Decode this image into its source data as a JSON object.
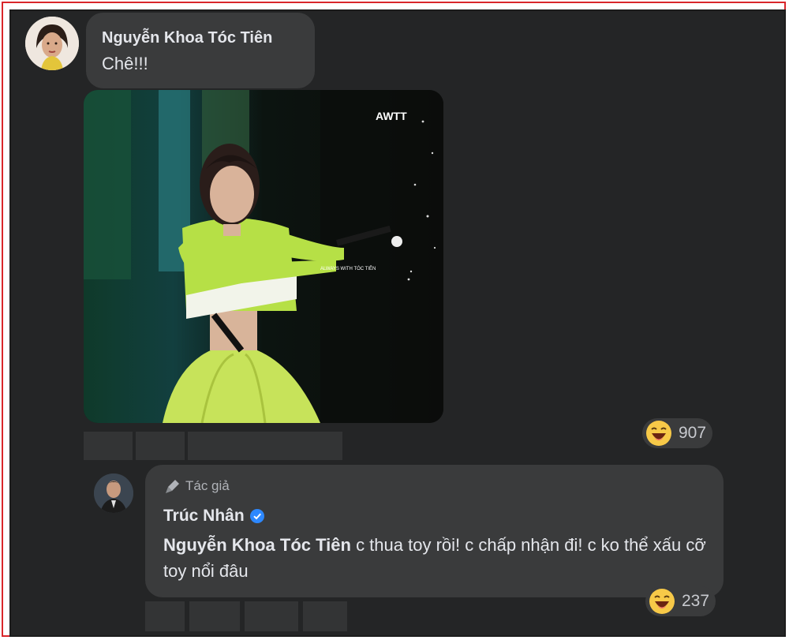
{
  "comment": {
    "author": "Nguyễn Khoa Tóc Tiên",
    "text": "Chê!!!",
    "photo_watermark_top": "AWTT",
    "photo_watermark_mid": "ALWAYS WITH TÓC TIÊN",
    "reaction_icon": "laughing-emoji-icon",
    "reaction_count": "907"
  },
  "reply": {
    "author_tag": "Tác giả",
    "author": "Trúc Nhân",
    "verified_icon": "verified-badge-icon",
    "mention": "Nguyễn Khoa Tóc Tiên",
    "text": " c thua toy rồi! c chấp nhận đi! c ko thể xấu cỡ toy nổi đâu",
    "reaction_icon": "laughing-emoji-icon",
    "reaction_count": "237"
  },
  "colors": {
    "background": "#242526",
    "bubble": "#3a3b3c",
    "text": "#e4e6eb",
    "muted": "#b0b3b8",
    "verified": "#2d88ff",
    "outer_border": "#d9262b"
  }
}
